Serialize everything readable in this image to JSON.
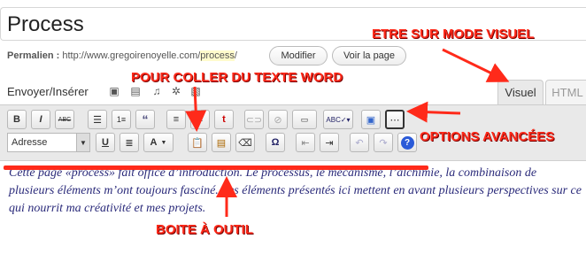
{
  "post": {
    "title": "Process"
  },
  "permalink": {
    "label": "Permalien :",
    "url_base": "http://www.gregoirenoyelle.com/",
    "slug": "process",
    "url_end": "/",
    "edit_button": "Modifier",
    "view_button": "Voir la page"
  },
  "upload": {
    "label": "Envoyer/Insérer"
  },
  "tabs": {
    "visual": "Visuel",
    "html": "HTML"
  },
  "toolbar": {
    "row1": [
      "B",
      "I",
      "ABC",
      "ul",
      "ol",
      "quote",
      "align-left",
      "align-center",
      "align-right",
      "link",
      "unlink",
      "more",
      "spellcheck",
      "fullscreen",
      "kitchen-sink"
    ],
    "format_select": "Adresse",
    "row2": [
      "U",
      "justify",
      "A",
      "paste-word",
      "paste-text",
      "eraser",
      "Ω",
      "outdent",
      "indent",
      "undo",
      "redo",
      "help"
    ]
  },
  "content": {
    "text": "Cette page «process» fait office d’introduction. Le processus, le mécanisme, l’alchimie, la combinaison de plusieurs éléments m’ont toujours fasciné. Les éléments présentés ici mettent en avant plusieurs perspectives sur ce qui nourrit ma créativité et mes projets."
  },
  "annotations": {
    "visual_mode": "ETRE SUR MODE VISUEL",
    "paste_word": "POUR COLLER DU TEXTE WORD",
    "advanced": "OPTIONS AVANCÉES",
    "toolbox": "BOITE À OUTIL"
  },
  "colors": {
    "annotation": "#ff2a1a",
    "content_text": "#2a2a7a"
  }
}
